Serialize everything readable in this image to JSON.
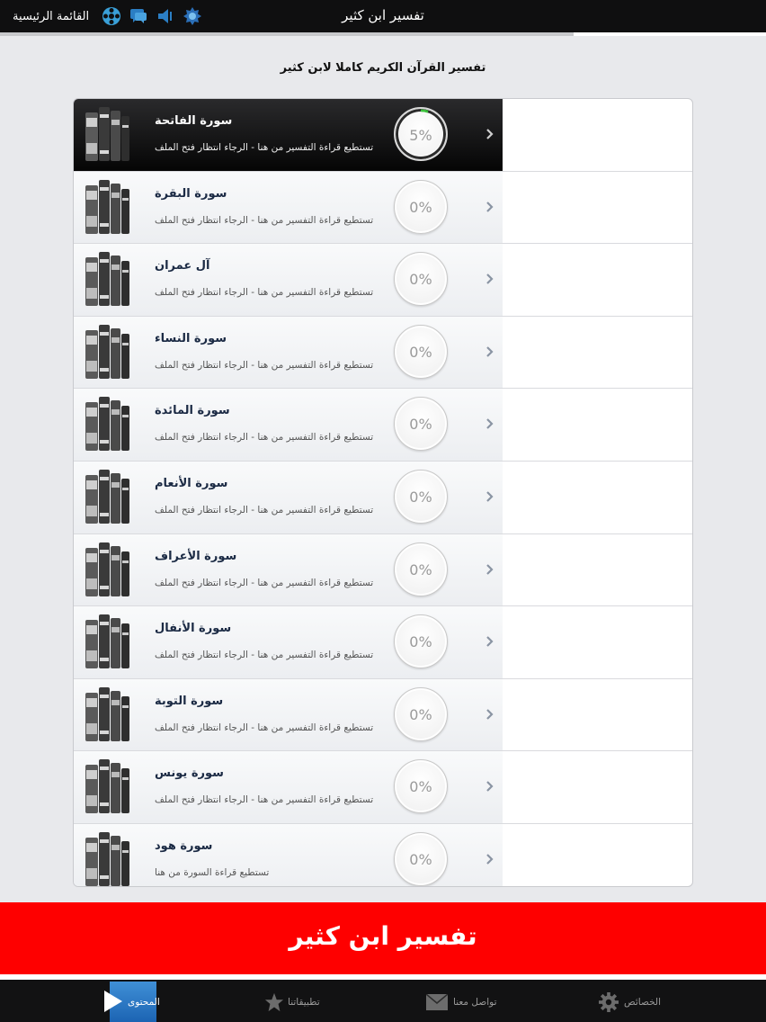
{
  "header": {
    "title": "تفسير ابن كثير",
    "menu_label": "القائمة الرئيسية",
    "icons": [
      "logo-icon",
      "speaker-icon",
      "chat-icon",
      "reel-icon"
    ]
  },
  "subtitle": "تفسير القرآن الكريم كاملا لابن كثير",
  "surahs": [
    {
      "name": "سورة الفاتحة",
      "desc": "تستطيع قراءة التفسير من هنا - الرجاء انتظار فتح الملف",
      "progress": "5%",
      "progress_value": 0.05,
      "selected": true
    },
    {
      "name": "سورة البقرة",
      "desc": "تستطيع قراءة التفسير من هنا - الرجاء انتظار فتح الملف",
      "progress": "0%",
      "progress_value": 0
    },
    {
      "name": "آل عمران",
      "desc": "تستطيع قراءة التفسير من هنا - الرجاء انتظار فتح الملف",
      "progress": "0%",
      "progress_value": 0
    },
    {
      "name": "سورة النساء",
      "desc": "تستطيع قراءة التفسير من هنا - الرجاء انتظار فتح الملف",
      "progress": "0%",
      "progress_value": 0
    },
    {
      "name": "سورة المائدة",
      "desc": "تستطيع قراءة التفسير من هنا - الرجاء انتظار فتح الملف",
      "progress": "0%",
      "progress_value": 0
    },
    {
      "name": "سورة الأنعام",
      "desc": "تستطيع قراءة التفسير من هنا - الرجاء انتظار فتح الملف",
      "progress": "0%",
      "progress_value": 0
    },
    {
      "name": "سورة الأعراف",
      "desc": "تستطيع قراءة التفسير من هنا - الرجاء انتظار فتح الملف",
      "progress": "0%",
      "progress_value": 0
    },
    {
      "name": "سورة الأنفال",
      "desc": "تستطيع قراءة التفسير من هنا - الرجاء انتظار فتح الملف",
      "progress": "0%",
      "progress_value": 0
    },
    {
      "name": "سورة التوبة",
      "desc": "تستطيع قراءة التفسير من هنا - الرجاء انتظار فتح الملف",
      "progress": "0%",
      "progress_value": 0
    },
    {
      "name": "سورة يونس",
      "desc": "تستطيع قراءة التفسير من هنا - الرجاء انتظار فتح الملف",
      "progress": "0%",
      "progress_value": 0
    },
    {
      "name": "سورة هود",
      "desc": "تستطيع قراءة السورة من هنا",
      "progress": "0%",
      "progress_value": 0
    }
  ],
  "banner": {
    "text": "تفسير ابن كثير",
    "color": "#fe0000"
  },
  "tabbar": {
    "tabs": [
      {
        "label": "المحتوى",
        "icon": "play-icon",
        "active": true
      },
      {
        "label": "تطبيقاتنا",
        "icon": "star-icon"
      },
      {
        "label": "تواصل معنا",
        "icon": "envelope-icon"
      },
      {
        "label": "الخصائص",
        "icon": "gear-icon"
      }
    ]
  },
  "colors": {
    "accent": "#1c64b3",
    "progress_green": "#3cc23c"
  }
}
